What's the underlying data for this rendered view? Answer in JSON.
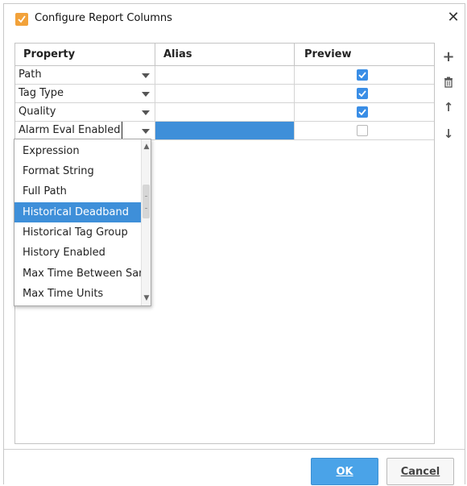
{
  "window": {
    "title": "Configure Report Columns",
    "close_glyph": "✕"
  },
  "table": {
    "headers": [
      "Property",
      "Alias",
      "Preview"
    ],
    "rows": [
      {
        "property": "Path",
        "alias": "",
        "preview": true
      },
      {
        "property": "Tag Type",
        "alias": "",
        "preview": true
      },
      {
        "property": "Quality",
        "alias": "",
        "preview": true
      },
      {
        "property": "Alarm Eval Enabled",
        "alias": "",
        "preview": false
      }
    ]
  },
  "side_buttons": {
    "add": "+",
    "delete_icon": "trash-icon",
    "up": "↑",
    "down": "↓"
  },
  "dropdown": {
    "items": [
      "Expression",
      "Format String",
      "Full Path",
      "Historical Deadband",
      "Historical Tag Group",
      "History Enabled",
      "Max Time Between Sar",
      "Max Time Units"
    ],
    "selected": "Historical Deadband"
  },
  "footer": {
    "ok_label": "OK",
    "cancel_label": "Cancel"
  },
  "colors": {
    "accent": "#3e8fd9",
    "checkbox": "#3a8ee6",
    "app_icon": "#f2a23a"
  }
}
